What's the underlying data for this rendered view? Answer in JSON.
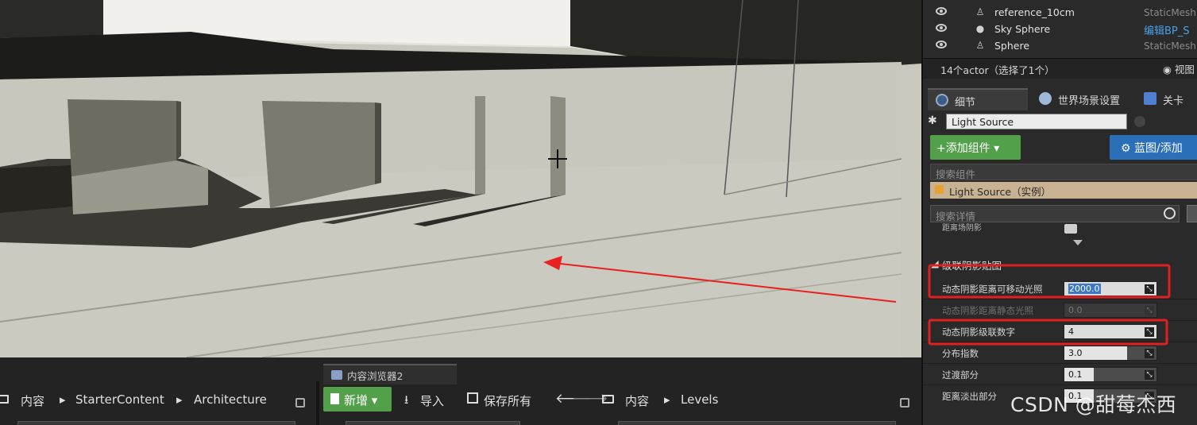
{
  "outliner": {
    "rows": [
      {
        "label": "reference_10cm",
        "type": "StaticMesh",
        "icon": "mannequin-icon"
      },
      {
        "label": "Sky Sphere",
        "type": "编辑BP_S",
        "icon": "sphere-icon"
      },
      {
        "label": "Sphere",
        "type": "StaticMesh",
        "icon": "mannequin-icon"
      }
    ],
    "summary": "14个actor（选择了1个）",
    "view_label": "视图"
  },
  "tabs": {
    "details": "细节",
    "world_settings": "世界场景设置",
    "levels": "关卡"
  },
  "details": {
    "actor_name": "Light Source",
    "add_component": "+添加组件",
    "blueprint": "蓝图/添加",
    "search_components_placeholder": "搜索组件",
    "instance_label": "Light Source（实例）",
    "search_details_placeholder": "搜索详情",
    "distance_field_shadow_label": "距离场阴影",
    "section_cascaded": "级联阴影贴图",
    "properties": [
      {
        "label": "动态阴影距离可移动光照",
        "value": "2000.0"
      },
      {
        "label": "动态阴影距离静态光照",
        "value": "0.0"
      },
      {
        "label": "动态阴影级联数字",
        "value": "4"
      },
      {
        "label": "分布指数",
        "value": "3.0"
      },
      {
        "label": "过渡部分",
        "value": "0.1"
      },
      {
        "label": "距离淡出部分",
        "value": "0.1"
      }
    ]
  },
  "content_browser": {
    "left_path": [
      "内容",
      "StarterContent",
      "Architecture"
    ],
    "tab_label": "内容浏览器2",
    "new_button": "新增",
    "import_button": "导入",
    "save_all_button": "保存所有",
    "right_path": [
      "内容",
      "Levels"
    ]
  },
  "colors": {
    "highlight_box": "#e02020",
    "arrow": "#e82020",
    "green_button": "#52a04a",
    "blue_button": "#2a6fb8"
  },
  "watermark": "CSDN @甜莓杰西"
}
